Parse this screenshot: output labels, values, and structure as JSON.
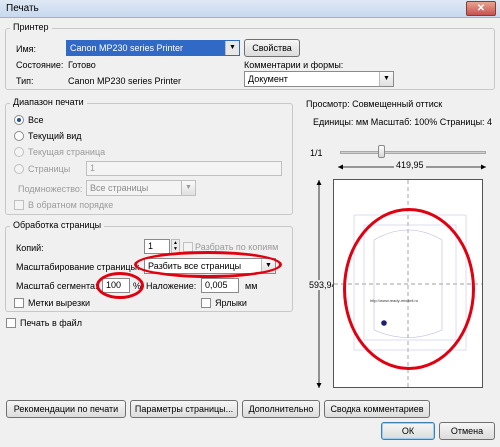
{
  "window": {
    "title": "Печать",
    "close_glyph": "✕"
  },
  "printer": {
    "group_title": "Принтер",
    "name_label": "Имя:",
    "name_value": "Canon MP230 series Printer",
    "properties_button": "Свойства",
    "status_label": "Состояние:",
    "status_value": "Готово",
    "type_label": "Тип:",
    "type_value": "Canon MP230 series Printer",
    "comments_label": "Комментарии и формы:",
    "comments_value": "Документ"
  },
  "range": {
    "group_title": "Диапазон печати",
    "all": "Все",
    "current_view": "Текущий вид",
    "current_page": "Текущая страница",
    "pages": "Страницы",
    "pages_value": "1",
    "subset_label": "Подмножество:",
    "subset_value": "Все страницы",
    "reverse": "В обратном порядке"
  },
  "handling": {
    "group_title": "Обработка страницы",
    "copies_label": "Копий:",
    "copies_value": "1",
    "collate": "Разбрать по копиям",
    "scaling_label": "Масштабирование страницы:",
    "scaling_value": "Разбить все страницы",
    "tile_scale_label": "Масштаб сегмента:",
    "tile_scale_value": "100",
    "percent": "%",
    "overlap_label": "Наложение:",
    "overlap_value": "0,005",
    "overlap_unit": "мм",
    "cut_marks": "Метки вырезки",
    "labels": "Ярлыки"
  },
  "print_to_file": "Печать в файл",
  "preview": {
    "title": "Просмотр: Совмещенный оттиск",
    "units": "Единицы: мм Масштаб: 100% Страницы: 4",
    "page_counter": "1/1",
    "width_value": "419,95",
    "height_value": "593,94",
    "url_text": "http://www.ready-mixdeli.ru"
  },
  "buttons": {
    "advice": "Рекомендации по печати",
    "page_setup": "Параметры страницы...",
    "advanced": "Дополнительно",
    "summarize": "Сводка комментариев",
    "ok": "ОК",
    "cancel": "Отмена"
  },
  "colors": {
    "highlight": "#e00010",
    "selection": "#3169c6"
  }
}
